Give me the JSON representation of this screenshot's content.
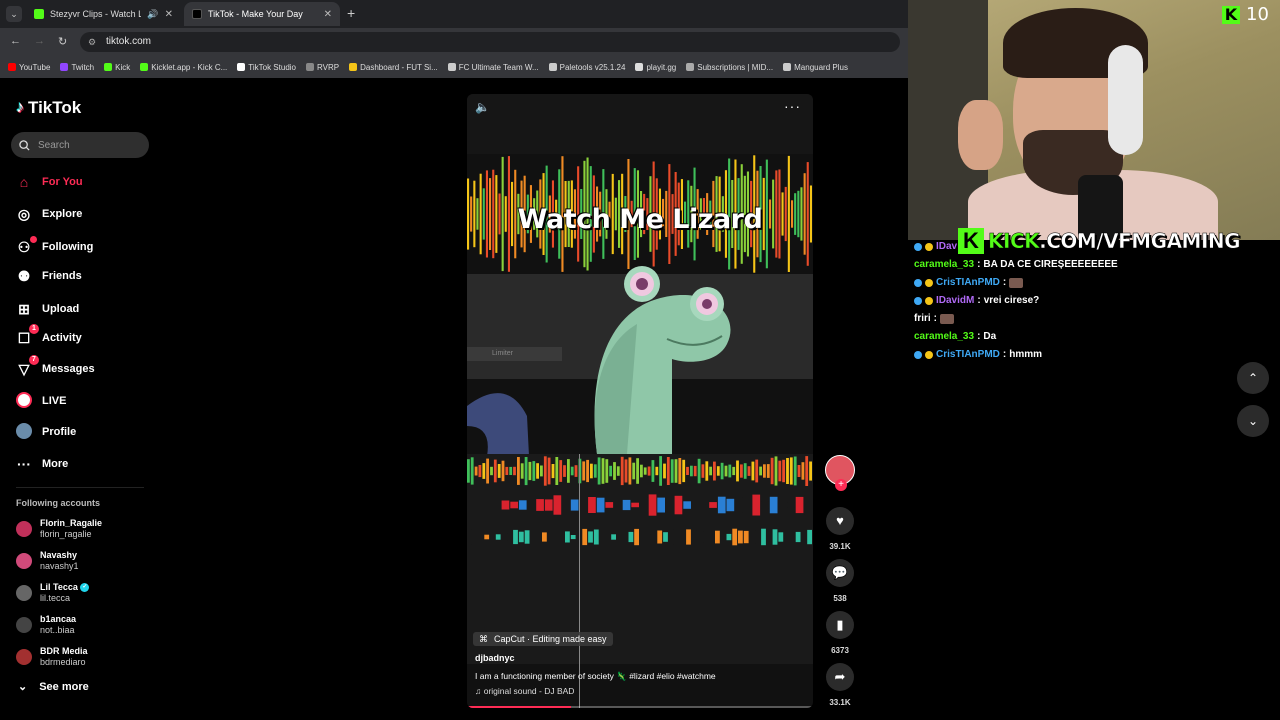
{
  "browser": {
    "tabs": [
      {
        "title": "Stezyvr Clips - Watch Live o",
        "favicon_color": "#53fc18",
        "active": false
      },
      {
        "title": "TikTok - Make Your Day",
        "favicon_color": "#000000",
        "active": true
      }
    ],
    "url": "tiktok.com",
    "bookmarks": [
      {
        "label": "YouTube",
        "color": "#ff0000"
      },
      {
        "label": "Twitch",
        "color": "#9146ff"
      },
      {
        "label": "Kick",
        "color": "#53fc18"
      },
      {
        "label": "Kicklet.app - Kick C...",
        "color": "#53fc18"
      },
      {
        "label": "TikTok Studio",
        "color": "#ffffff"
      },
      {
        "label": "RVRP",
        "color": "#888888"
      },
      {
        "label": "Dashboard - FUT Si...",
        "color": "#f5c518"
      },
      {
        "label": "FC Ultimate Team W...",
        "color": "#cccccc"
      },
      {
        "label": "Paletools v25.1.24",
        "color": "#cccccc"
      },
      {
        "label": "playit.gg",
        "color": "#dddddd"
      },
      {
        "label": "Subscriptions | MID...",
        "color": "#aaaaaa"
      },
      {
        "label": "Manguard Plus",
        "color": "#cccccc"
      }
    ]
  },
  "tiktok": {
    "brand": "TikTok",
    "search_placeholder": "Search",
    "nav": [
      {
        "label": "For You",
        "icon": "home-icon"
      },
      {
        "label": "Explore",
        "icon": "compass-icon"
      },
      {
        "label": "Following",
        "icon": "following-icon"
      },
      {
        "label": "Friends",
        "icon": "friends-icon"
      },
      {
        "label": "Upload",
        "icon": "upload-icon"
      },
      {
        "label": "Activity",
        "icon": "activity-icon",
        "badge": "1"
      },
      {
        "label": "Messages",
        "icon": "messages-icon",
        "badge": "7"
      },
      {
        "label": "LIVE",
        "icon": "live-icon"
      },
      {
        "label": "Profile",
        "icon": "profile-icon"
      },
      {
        "label": "More",
        "icon": "more-icon"
      }
    ],
    "following_title": "Following accounts",
    "accounts": [
      {
        "name": "Florin_Ragalie",
        "handle": "florin_ragalie",
        "color": "#c0305a"
      },
      {
        "name": "Navashy",
        "handle": "navashy1",
        "color": "#d04a7a"
      },
      {
        "name": "Lil Tecca",
        "handle": "lil.tecca",
        "color": "#666666",
        "verified": true
      },
      {
        "name": "b1ancaa",
        "handle": "not..biaa",
        "color": "#444444"
      },
      {
        "name": "BDR Media",
        "handle": "bdrmediaro",
        "color": "#a23030"
      }
    ],
    "see_more": "See more",
    "video": {
      "title": "Watch Me Lizard",
      "limiter": "Limiter",
      "capcut": "CapCut · Editing made easy",
      "author": "djbadnyc",
      "description": "I am a functioning member of society 🦎 #lizard #elio #watchme",
      "sound": "♫ original sound - DJ BAD",
      "progress": 0.3
    },
    "actions": {
      "likes": "39.1K",
      "comments": "538",
      "saves": "6373",
      "shares": "33.1K"
    }
  },
  "overlay": {
    "kick_count": "10",
    "banner_prefix": "KICK",
    "banner_rest": ".COM/VFMGAMING",
    "chat": [
      {
        "user": "IDav",
        "text": "",
        "color": "#b06af5",
        "badges": true
      },
      {
        "user": "caramela_33",
        "text": "BA DA CE CIREȘEEEEEEEE",
        "color": "#53fc18",
        "badges": false
      },
      {
        "user": "CrisTIAnPMD",
        "text": "",
        "color": "#3fa9f5",
        "badges": true,
        "emote": true
      },
      {
        "user": "IDavidM",
        "text": "vrei cirese?",
        "color": "#b06af5",
        "badges": true
      },
      {
        "user": "friri",
        "text": "",
        "color": "#ffffff",
        "badges": false,
        "emote": true
      },
      {
        "user": "caramela_33",
        "text": "Da",
        "color": "#53fc18",
        "badges": false
      },
      {
        "user": "CrisTIAnPMD",
        "text": "hmmm",
        "color": "#3fa9f5",
        "badges": true
      }
    ]
  }
}
